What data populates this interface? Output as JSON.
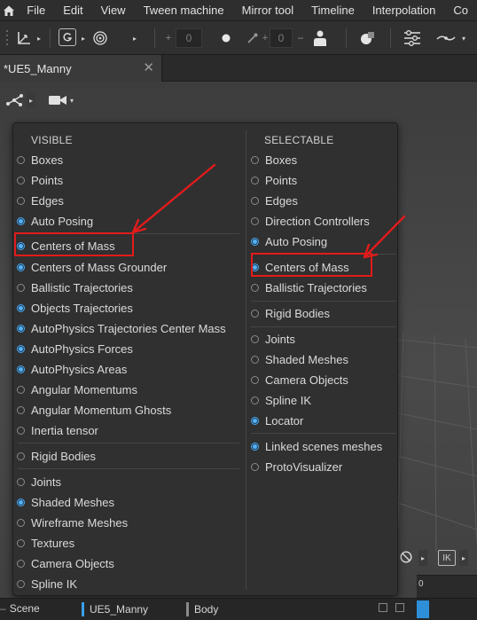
{
  "menubar": {
    "home_icon": "home-icon",
    "items": [
      "File",
      "Edit",
      "View",
      "Tween machine",
      "Mirror tool",
      "Timeline",
      "Interpolation",
      "Co"
    ]
  },
  "toolbar": {
    "field1_value": "0",
    "field2_value": "0",
    "field1_prefix": "+",
    "field2_prefix": "+"
  },
  "tabs": [
    {
      "title": "*UE5_Manny",
      "close_glyph": "✕"
    }
  ],
  "viewport": {
    "camera_icon": "camera-icon",
    "graph_icon": "graph-icon",
    "ik_label": "IK",
    "timeline_zero": "0"
  },
  "popup": {
    "visible": {
      "header": "VISIBLE",
      "items": [
        {
          "label": "Boxes",
          "on": false
        },
        {
          "label": "Points",
          "on": false
        },
        {
          "label": "Edges",
          "on": false
        },
        {
          "label": "Auto Posing",
          "on": true
        },
        {
          "label": "Centers of Mass",
          "on": true
        },
        {
          "label": "Centers of Mass Grounder",
          "on": true
        },
        {
          "label": "Ballistic Trajectories",
          "on": false
        },
        {
          "label": "Objects Trajectories",
          "on": true
        },
        {
          "label": "AutoPhysics Trajectories Center Mass",
          "on": true
        },
        {
          "label": "AutoPhysics Forces",
          "on": true
        },
        {
          "label": "AutoPhysics Areas",
          "on": true
        },
        {
          "label": "Angular Momentums",
          "on": false
        },
        {
          "label": "Angular Momentum Ghosts",
          "on": false
        },
        {
          "label": "Inertia tensor",
          "on": false
        },
        {
          "label": "Rigid Bodies",
          "on": false
        },
        {
          "label": "Joints",
          "on": false
        },
        {
          "label": "Shaded Meshes",
          "on": true
        },
        {
          "label": "Wireframe Meshes",
          "on": false
        },
        {
          "label": "Textures",
          "on": false
        },
        {
          "label": "Camera Objects",
          "on": false
        },
        {
          "label": "Spline IK",
          "on": false
        }
      ]
    },
    "selectable": {
      "header": "SELECTABLE",
      "items": [
        {
          "label": "Boxes",
          "on": false
        },
        {
          "label": "Points",
          "on": false
        },
        {
          "label": "Edges",
          "on": false
        },
        {
          "label": "Direction Controllers",
          "on": false
        },
        {
          "label": "Auto Posing",
          "on": true
        },
        {
          "label": "Centers of Mass",
          "on": true
        },
        {
          "label": "Ballistic Trajectories",
          "on": false
        },
        {
          "label": "Rigid Bodies",
          "on": false
        },
        {
          "label": "Joints",
          "on": false
        },
        {
          "label": "Shaded Meshes",
          "on": false
        },
        {
          "label": "Camera Objects",
          "on": false
        },
        {
          "label": "Spline IK",
          "on": false
        },
        {
          "label": "Locator",
          "on": true
        },
        {
          "label": "Linked scenes meshes",
          "on": true
        },
        {
          "label": "ProtoVisualizer",
          "on": false
        }
      ]
    }
  },
  "bottombar": {
    "scene_label": "Scene",
    "manny_label": "UE5_Manny",
    "body_label": "Body"
  },
  "colors": {
    "accent": "#4aa8f0",
    "highlight": "#e21b1b",
    "panel": "#303030"
  }
}
